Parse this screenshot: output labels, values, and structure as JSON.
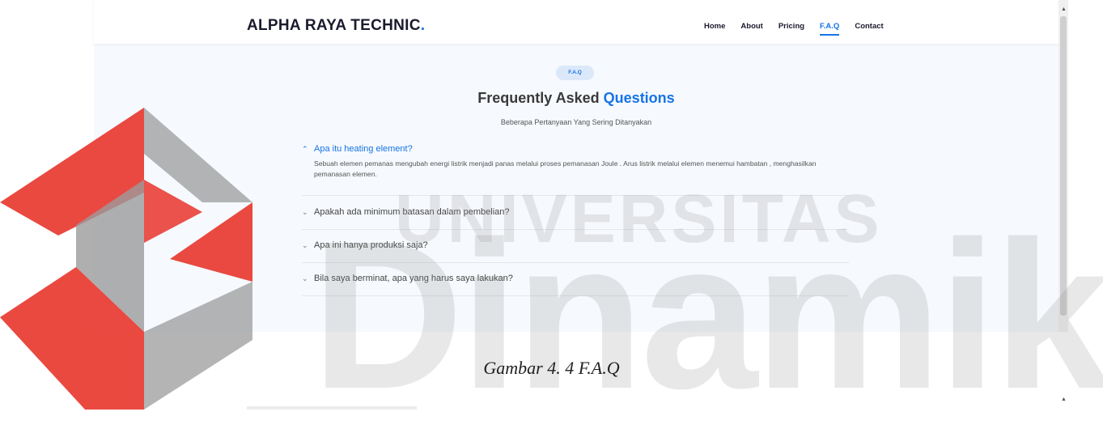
{
  "navbar": {
    "brand": "ALPHA RAYA TECHNIC",
    "brand_dot": ".",
    "links": [
      "Home",
      "About",
      "Pricing",
      "F.A.Q",
      "Contact"
    ],
    "active_link": "F.A.Q"
  },
  "faq": {
    "badge": "F.A.Q",
    "title_main": "Frequently Asked ",
    "title_highlight": "Questions",
    "subtitle": "Beberapa Pertanyaan Yang Sering Ditanyakan",
    "items": [
      {
        "question": "Apa itu heating element?",
        "answer": "Sebuah elemen pemanas mengubah energi listrik menjadi panas melalui proses pemanasan Joule . Arus listrik melalui elemen menemui hambatan , menghasilkan pemanasan elemen.",
        "expanded": true,
        "icon": "chevron-up-icon"
      },
      {
        "question": "Apakah ada minimum batasan dalam pembelian?",
        "expanded": false,
        "icon": "chevron-down-icon"
      },
      {
        "question": "Apa ini hanya produksi saja?",
        "expanded": false,
        "icon": "chevron-down-icon"
      },
      {
        "question": "Bila saya berminat, apa yang harus saya lakukan?",
        "expanded": false,
        "icon": "chevron-down-icon"
      }
    ]
  },
  "caption": "Gambar 4. 4 F.A.Q",
  "watermark": {
    "word_top": "UNIVERSITAS",
    "word_main": "Dinamika"
  },
  "colors": {
    "accent": "#1673e6",
    "logo_red": "#e8352b",
    "logo_grey": "#9b9b9b"
  }
}
